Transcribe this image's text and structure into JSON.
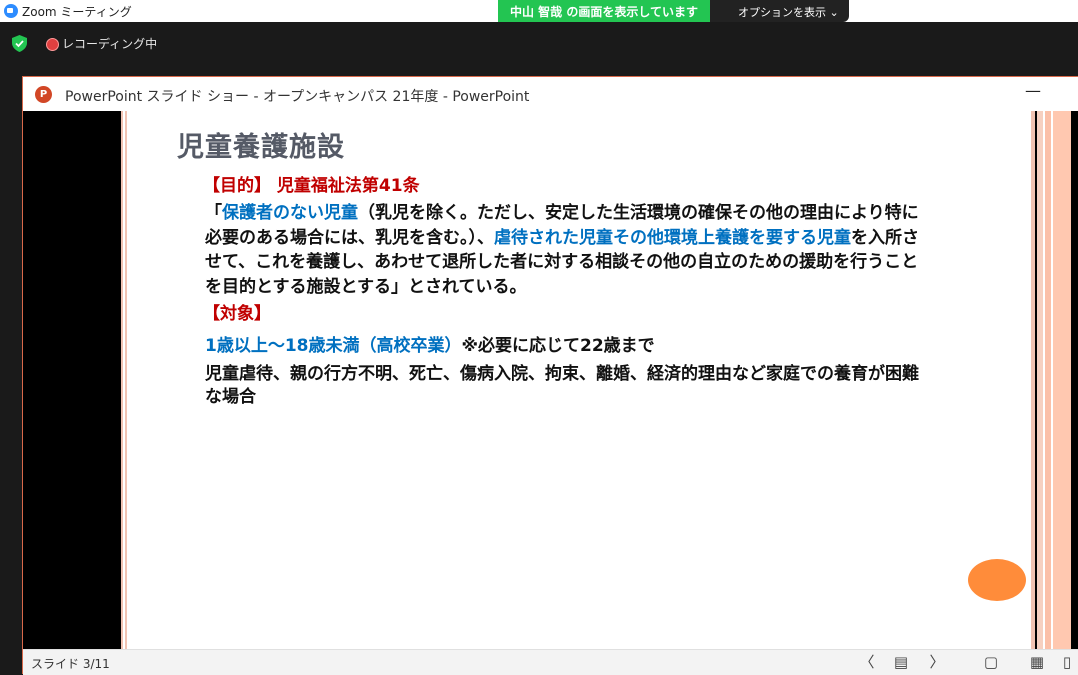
{
  "zoom": {
    "window_title": "Zoom ミーティング",
    "share_banner": "中山 智哉 の画面を表示しています",
    "options_label": "オプションを表示 ⌄",
    "recording_label": "レコーディング中"
  },
  "ppt": {
    "window_title": "PowerPoint スライド ショー  -  オープンキャンパス  21年度 - PowerPoint",
    "logo_letter": "P",
    "minimize": "—",
    "status": {
      "slide_counter": "スライド 3/11"
    }
  },
  "slide": {
    "title": "児童養護施設",
    "purpose_heading": "【目的】",
    "purpose_law": "児童福祉法第41条",
    "para_open": "「",
    "para_blue1": "保護者のない児童",
    "para_mid1": "（乳児を除く。ただし、安定した生活環境の確保その他の理由により特に必要のある場合には、乳児を含む。）、",
    "para_blue2": "虐待された児童その他環境上養護を要する児童",
    "para_rest": "を入所させて、これを養護し、あわせて退所した者に対する相談その他の自立のための援助を行うことを目的とする施設とする」とされている。",
    "target_heading": "【対象】",
    "age_blue": "1歳以上〜18歳未満（高校卒業）",
    "age_rest": "※必要に応じて22歳まで",
    "conditions": "児童虐待、親の行方不明、死亡、傷病入院、拘束、離婚、経済的理由など家庭での養育が困難な場合"
  },
  "icons": {
    "prev": "〈",
    "notes": "▤",
    "next": "〉",
    "normal_view": "▢",
    "sorter_view": "▦",
    "reading_view": "▯"
  }
}
